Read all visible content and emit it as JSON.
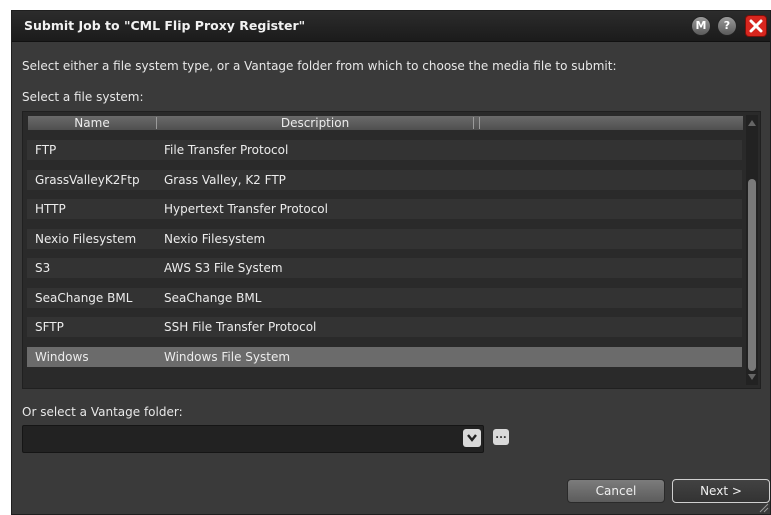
{
  "window": {
    "title": "Submit Job to \"CML Flip Proxy Register\"",
    "buttons": {
      "m": "M",
      "help": "?"
    }
  },
  "instructions": "Select either a file system type, or a Vantage folder from which to choose the media file to submit:",
  "filesystem_label": "Select a file system:",
  "table": {
    "columns": [
      "Name",
      "Description"
    ],
    "rows": [
      {
        "name": "FTP",
        "description": "File Transfer Protocol"
      },
      {
        "name": "GrassValleyK2Ftp",
        "description": "Grass Valley, K2 FTP"
      },
      {
        "name": "HTTP",
        "description": "Hypertext Transfer Protocol"
      },
      {
        "name": "Nexio Filesystem",
        "description": "Nexio Filesystem"
      },
      {
        "name": "S3",
        "description": "AWS S3 File System"
      },
      {
        "name": "SeaChange BML",
        "description": "SeaChange BML"
      },
      {
        "name": "SFTP",
        "description": "SSH File Transfer Protocol"
      },
      {
        "name": "Windows",
        "description": "Windows File System"
      }
    ],
    "selected_index": 7
  },
  "folder_label": "Or select a Vantage folder:",
  "folder_value": "",
  "browse_label": "...",
  "buttons": {
    "cancel": "Cancel",
    "next": "Next >"
  },
  "icons": [
    "close-icon",
    "chevron-down-icon",
    "resize-grip-icon"
  ]
}
